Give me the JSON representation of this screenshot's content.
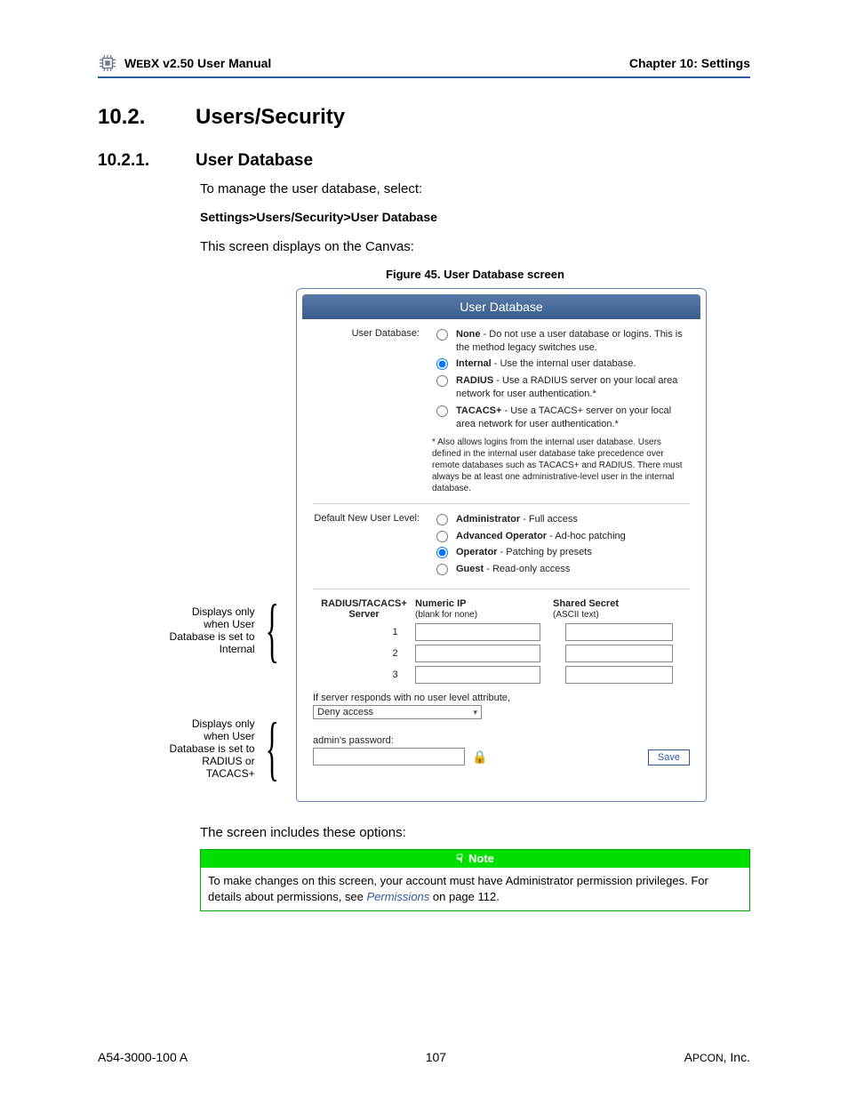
{
  "header": {
    "manual_prefix": "W",
    "manual_mid": "EB",
    "manual_suffix": "X v2.50 User Manual",
    "chapter": "Chapter 10: Settings"
  },
  "h1_num": "10.2.",
  "h1_text": "Users/Security",
  "h2_num": "10.2.1.",
  "h2_text": "User Database",
  "intro1": "To manage the user database, select:",
  "navpath": "Settings>Users/Security>User Database",
  "intro2": "This screen displays on the Canvas:",
  "figcap": "Figure 45. User Database screen",
  "annot": {
    "a1": "Displays only when User Database is set to Internal",
    "a2": "Displays only when User Database is set to RADIUS or TACACS+"
  },
  "panel": {
    "title": "User Database",
    "row1_label": "User Database:",
    "opts1": {
      "none_b": "None",
      "none_t": " - Do not use a user database or logins. This is the method legacy switches use.",
      "int_b": "Internal",
      "int_t": " - Use the internal user database.",
      "rad_b": "RADIUS",
      "rad_t": " - Use a RADIUS server on your local area network for user authentication.*",
      "tac_b": "TACACS+",
      "tac_t": " - Use a TACACS+ server on your local area network for user authentication.*"
    },
    "footnote": "* Also allows logins from the internal user database. Users defined in the internal user database take precedence over remote databases such as TACACS+ and RADIUS. There must always be at least one administrative-level user in the internal database.",
    "row2_label": "Default New User Level:",
    "opts2": {
      "admin_b": "Administrator",
      "admin_t": " - Full access",
      "adv_b": "Advanced Operator",
      "adv_t": " - Ad-hoc patching",
      "op_b": "Operator",
      "op_t": " - Patching by presets",
      "guest_b": "Guest",
      "guest_t": " - Read-only access"
    },
    "srv": {
      "h1": "RADIUS/TACACS+ Server",
      "h2": "Numeric IP",
      "h2s": "(blank for none)",
      "h3": "Shared Secret",
      "h3s": "(ASCII text)",
      "r1": "1",
      "r2": "2",
      "r3": "3",
      "nolevel": "If server responds with no user level attribute,",
      "dd": "Deny access"
    },
    "pwd_label": "admin's password:",
    "save": "Save"
  },
  "after": "The screen includes these options:",
  "note": {
    "title": "Note",
    "body_a": "To make changes on this screen, your account must have Administrator permission privileges. For details about permissions, see ",
    "link": "Permissions",
    "body_b": " on page 112."
  },
  "footer": {
    "left": "A54-3000-100 A",
    "center": "107",
    "right_a": "A",
    "right_b": "PCON",
    "right_c": ", Inc."
  }
}
